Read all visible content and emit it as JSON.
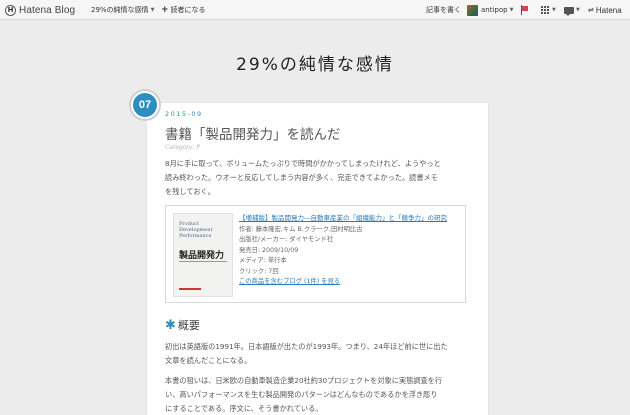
{
  "topbar": {
    "logo_mark": "H",
    "logo_text": "Hatena Blog",
    "blog_menu": "29%の純情な感情",
    "subscribe": "読者になる",
    "write": "記事を書く",
    "user": "antipop",
    "hatena": "Hatena"
  },
  "blog": {
    "title": "29%の純情な感情"
  },
  "entry": {
    "number": "07",
    "date": "2015-09",
    "title": "書籍「製品開発力」を読んだ",
    "category": "Category: P",
    "intro_lines": [
      "8月に手に取って、ボリュームたっぷりで時間がかかってしまったけれど、ようやっと",
      "読み終わった。ウオーと反応してしまう内容が多く、完走できてよかった。読書メモ",
      "を残しておく。"
    ],
    "product": {
      "book_en_lines": [
        "Product Development",
        "Performance"
      ],
      "book_jp": "製品開発力",
      "title": "【増補版】製品開発力―自動車産業の「組織能力」と「競争力」の研究",
      "author": "作者: 藤本隆宏,キム B.クラーク,田村明比古",
      "publisher": "出版社/メーカー: ダイヤモンド社",
      "release": "発売日: 2009/10/09",
      "media": "メディア: 単行本",
      "clicks": "クリック: 7回",
      "blog_link": "この商品を含むブログ (1件) を見る"
    },
    "section_heading": "概要",
    "section_star": "✱",
    "para2_lines": [
      "初出は英語版の1991年。日本語版が出たのが1993年。つまり、24年ほど前に世に出た",
      "文章を読んだことになる。"
    ],
    "para3_lines": [
      "本書の狙いは、日米欧の自動車製造企業20社約30プロジェクトを対象に実態調査を行",
      "い、高いパフォーマンスを生む製品開発のパターンはどんなものであるかを浮き彫り",
      "にすることである。序文に、そう書かれている。"
    ]
  }
}
